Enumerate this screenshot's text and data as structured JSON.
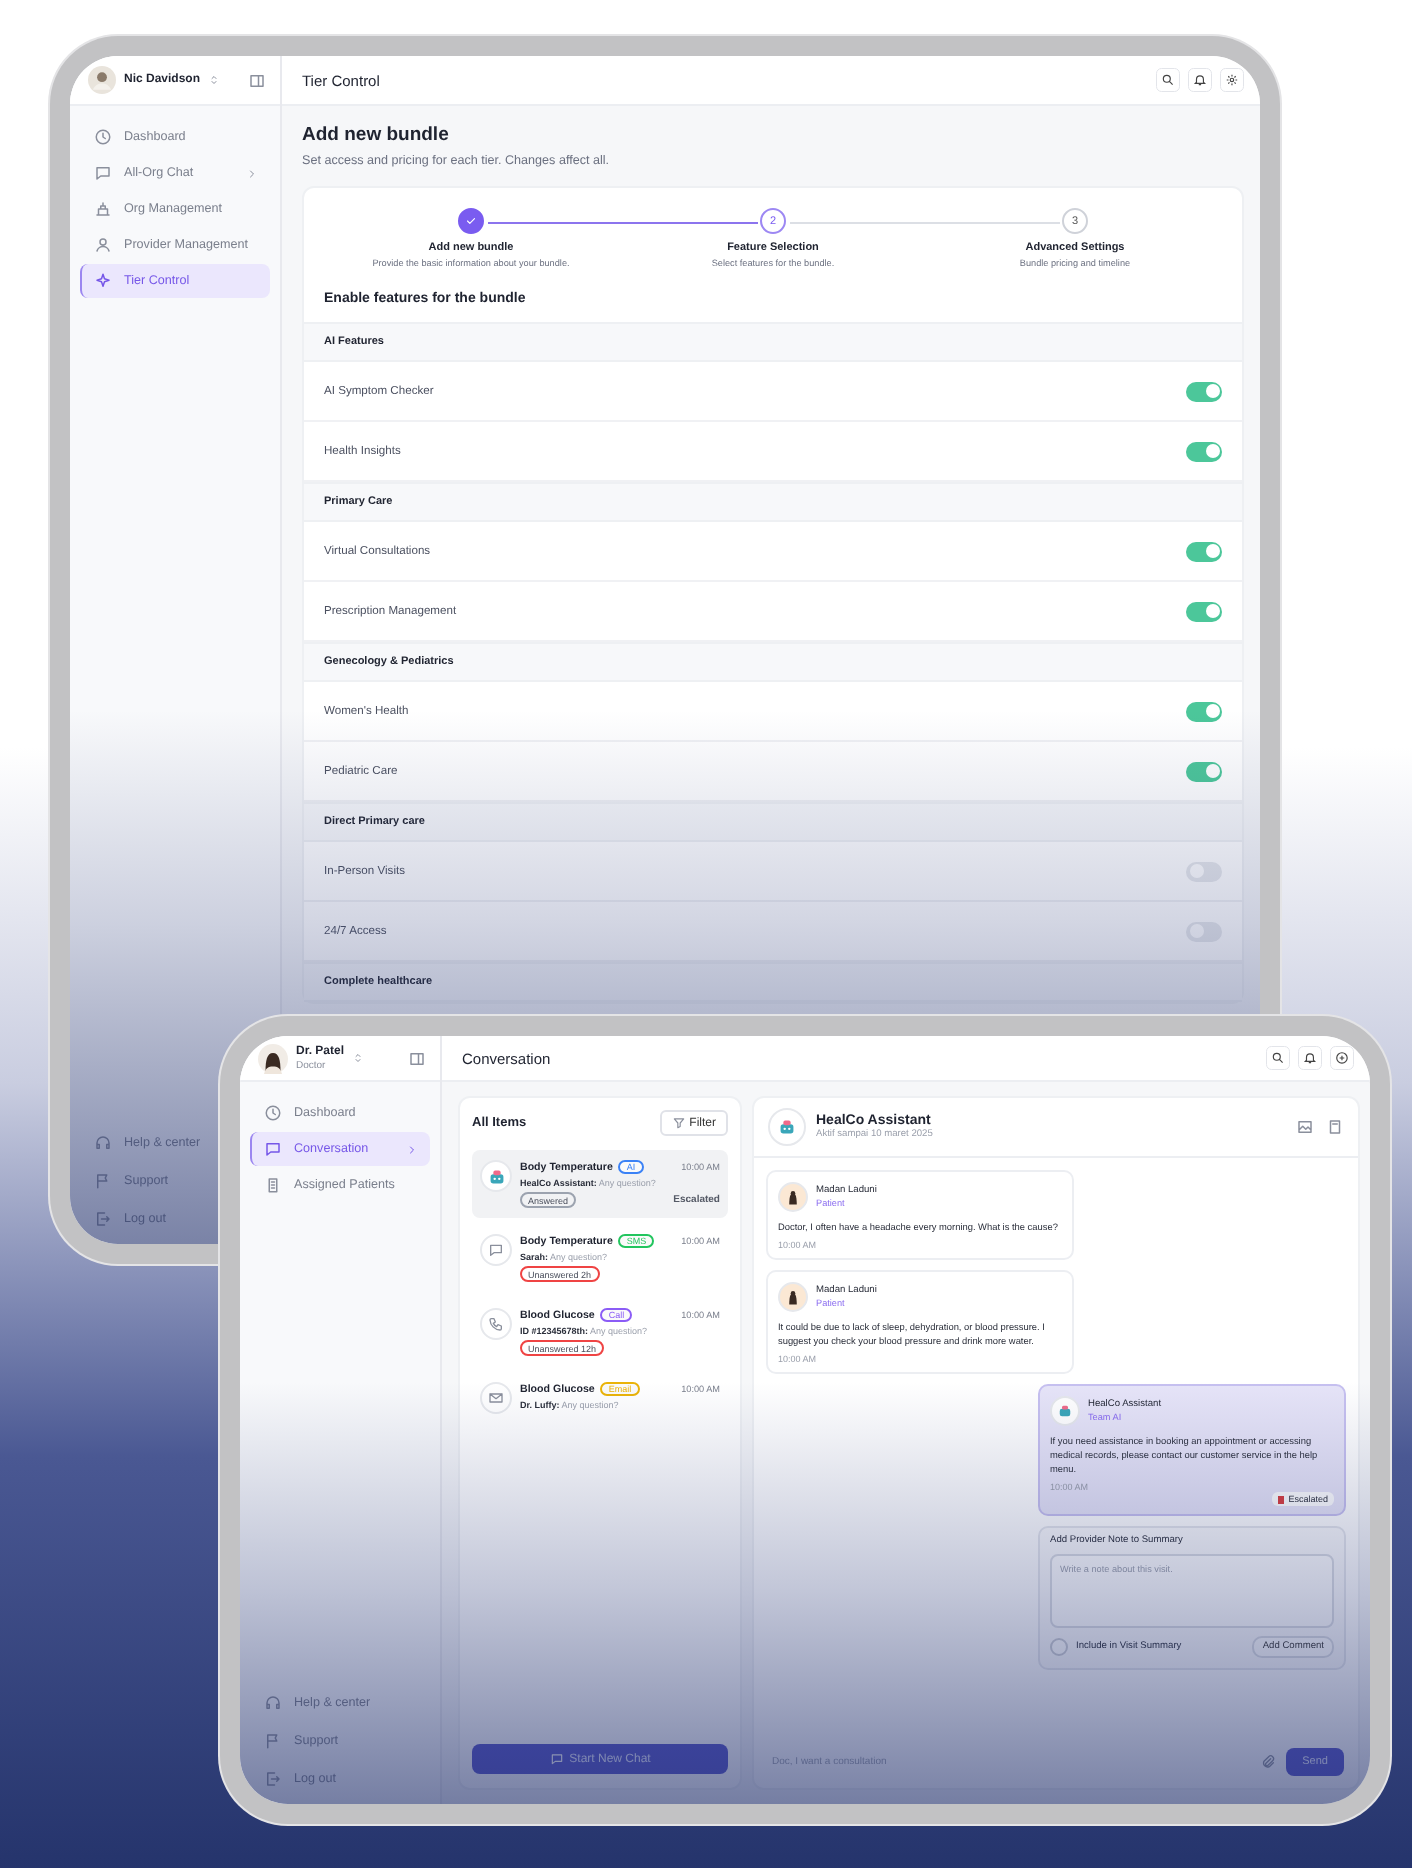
{
  "back_tablet": {
    "user": {
      "name": "Nic Davidson"
    },
    "sidebar": {
      "items": [
        {
          "label": "Dashboard",
          "selected": false,
          "expandable": false
        },
        {
          "label": "All-Org Chat",
          "selected": false,
          "expandable": true
        },
        {
          "label": "Org Management",
          "selected": false,
          "expandable": false
        },
        {
          "label": "Provider Management",
          "selected": false,
          "expandable": false
        },
        {
          "label": "Tier Control",
          "selected": true,
          "expandable": false
        }
      ],
      "footer_items": [
        {
          "label": "Help & center"
        },
        {
          "label": "Support"
        },
        {
          "label": "Log out"
        }
      ]
    },
    "header": {
      "title": "Tier Control"
    },
    "page": {
      "title": "Add new bundle",
      "subtitle": "Set access and pricing for each tier. Changes affect all."
    },
    "stepper": [
      {
        "label": "Add new bundle",
        "description": "Provide the basic information about your bundle.",
        "done": true,
        "selected": false
      },
      {
        "number": "2",
        "label": "Feature Selection",
        "description": "Select features for the bundle.",
        "done": false,
        "selected": true
      },
      {
        "number": "3",
        "label": "Advanced Settings",
        "description": "Bundle pricing and timeline",
        "done": false,
        "selected": false
      }
    ],
    "features_title": "Enable features for the bundle",
    "feature_groups": [
      {
        "title": "AI Features",
        "features": [
          {
            "label": "AI Symptom Checker",
            "on": true
          },
          {
            "label": "Health Insights",
            "on": true
          }
        ]
      },
      {
        "title": "Primary Care",
        "features": [
          {
            "label": "Virtual Consultations",
            "on": true
          },
          {
            "label": "Prescription Management",
            "on": true
          }
        ]
      },
      {
        "title": "Genecology & Pediatrics",
        "features": [
          {
            "label": "Women's Health",
            "on": true
          },
          {
            "label": "Pediatric Care",
            "on": true
          }
        ]
      },
      {
        "title": "Direct Primary care",
        "features": [
          {
            "label": "In-Person Visits",
            "on": false
          },
          {
            "label": "24/7 Access",
            "on": false
          }
        ]
      },
      {
        "title": "Complete healthcare"
      }
    ]
  },
  "front_tablet": {
    "user": {
      "name": "Dr. Patel",
      "role": "Doctor"
    },
    "sidebar": {
      "items": [
        {
          "label": "Dashboard",
          "selected": false,
          "expandable": false
        },
        {
          "label": "Conversation",
          "selected": true,
          "expandable": true
        },
        {
          "label": "Assigned Patients",
          "selected": false,
          "expandable": false
        }
      ],
      "footer_items": [
        {
          "label": "Help & center"
        },
        {
          "label": "Support"
        },
        {
          "label": "Log out"
        }
      ]
    },
    "header": {
      "title": "Conversation"
    },
    "inbox": {
      "title": "All Items",
      "filter_label": "Filter",
      "new_chat_label": "Start New Chat",
      "items": [
        {
          "kind": "ai",
          "title": "Body Temperature",
          "channel": {
            "label": "AI",
            "color": "#3b82f6"
          },
          "preview": "**HealCo Assistant:** Any question?",
          "time": "10:00 AM",
          "status": {
            "label": "Answered",
            "color": "#9ca3af"
          },
          "escalation": "Escalated",
          "selected": true
        },
        {
          "kind": "sms",
          "title": "Body Temperature",
          "channel": {
            "label": "SMS",
            "color": "#22c55e"
          },
          "preview": "**Sarah:** Any question?",
          "time": "10:00 AM",
          "status": {
            "label": "Unanswered 2h",
            "color": "#ef4444"
          },
          "selected": false
        },
        {
          "kind": "call",
          "title": "Blood Glucose",
          "channel": {
            "label": "Call",
            "color": "#8b5cf6"
          },
          "preview": "**ID #12345678th:** Any question?",
          "time": "10:00 AM",
          "status": {
            "label": "Unanswered 12h",
            "color": "#ef4444"
          },
          "selected": false
        },
        {
          "kind": "email",
          "title": "Blood Glucose",
          "channel": {
            "label": "Email",
            "color": "#eab308"
          },
          "preview": "**Dr. Luffy:** Any question?",
          "time": "10:00 AM",
          "selected": false
        }
      ]
    },
    "chat": {
      "title": "HealCo Assistant",
      "subtitle": "Aktif sampai 10 maret 2025",
      "messages": [
        {
          "kind": "patient",
          "name": "Madan Laduni",
          "role": "Patient",
          "text": "Doctor, I often have a headache every morning. What is the cause?",
          "time": "10:00 AM"
        },
        {
          "kind": "patient",
          "name": "Madan Laduni",
          "role": "Patient",
          "text": "It could be due to lack of sleep, dehydration, or blood pressure. I suggest you check your blood pressure and drink more water.",
          "time": "10:00 AM"
        },
        {
          "kind": "assistant",
          "name": "HealCo Assistant",
          "role": "Team AI",
          "text": "If you need assistance in booking an appointment or accessing medical records, please contact our customer service in the help menu.",
          "time": "10:00 AM",
          "badge": "Escalated"
        }
      ],
      "note": {
        "title": "Add Provider Note to Summary",
        "placeholder": "Write a note about this visit.",
        "checkbox_label": "Include in Visit Summary",
        "checked": false,
        "button": "Add Comment"
      },
      "composer": {
        "placeholder": "Doc, I want a consultation",
        "send": "Send"
      }
    }
  }
}
